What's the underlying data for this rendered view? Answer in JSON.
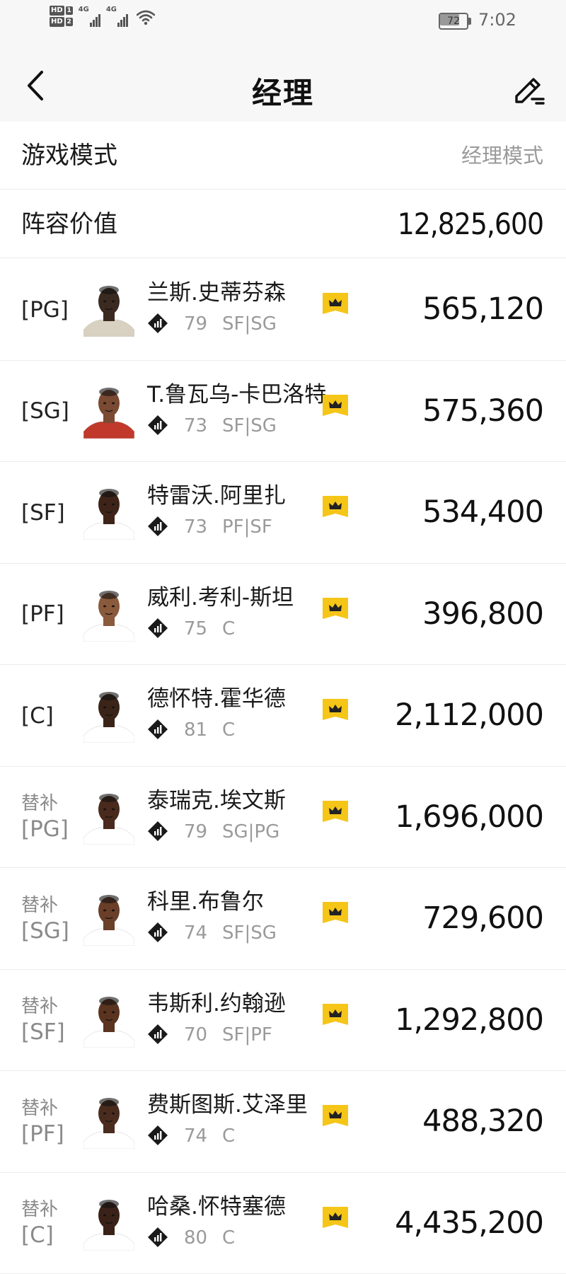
{
  "status_bar": {
    "sim1": "HD",
    "sim1_num": "1",
    "sim2": "HD",
    "sim2_num": "2",
    "network1": "4G",
    "network2": "4G",
    "battery": "72",
    "battery_level": 0.72,
    "time": "7:02"
  },
  "header": {
    "title": "经理",
    "back_icon": "chevron-left-icon",
    "edit_icon": "pencil-edit-icon"
  },
  "game_mode": {
    "label": "游戏模式",
    "value": "经理模式"
  },
  "lineup_value": {
    "label": "阵容价值",
    "value": "12,825,600"
  },
  "colors": {
    "crown": "#f5c518",
    "rating_icon": "#1a1a1a"
  },
  "players": [
    {
      "sub_label": "",
      "pos": "[PG]",
      "name": "兰斯.史蒂芬森",
      "rating": "79",
      "role": "SF|SG",
      "price": "565,120",
      "skin": "#3a2a20",
      "jersey": "#d8d0c0"
    },
    {
      "sub_label": "",
      "pos": "[SG]",
      "name": "T.鲁瓦乌-卡巴洛特",
      "rating": "73",
      "role": "SF|SG",
      "price": "575,360",
      "skin": "#7a4a32",
      "jersey": "#c0392b"
    },
    {
      "sub_label": "",
      "pos": "[SF]",
      "name": "特雷沃.阿里扎",
      "rating": "73",
      "role": "PF|SF",
      "price": "534,400",
      "skin": "#3e2418",
      "jersey": "#ffffff"
    },
    {
      "sub_label": "",
      "pos": "[PF]",
      "name": "威利.考利-斯坦",
      "rating": "75",
      "role": "C",
      "price": "396,800",
      "skin": "#8a5a3c",
      "jersey": "#ffffff"
    },
    {
      "sub_label": "",
      "pos": "[C]",
      "name": "德怀特.霍华德",
      "rating": "81",
      "role": "C",
      "price": "2,112,000",
      "skin": "#3a2418",
      "jersey": "#ffffff"
    },
    {
      "sub_label": "替补",
      "pos": "[PG]",
      "name": "泰瑞克.埃文斯",
      "rating": "79",
      "role": "SG|PG",
      "price": "1,696,000",
      "skin": "#4a2a1c",
      "jersey": "#ffffff"
    },
    {
      "sub_label": "替补",
      "pos": "[SG]",
      "name": "科里.布鲁尔",
      "rating": "74",
      "role": "SF|SG",
      "price": "729,600",
      "skin": "#6a3e28",
      "jersey": "#ffffff"
    },
    {
      "sub_label": "替补",
      "pos": "[SF]",
      "name": "韦斯利.约翰逊",
      "rating": "70",
      "role": "SF|PF",
      "price": "1,292,800",
      "skin": "#5a341f",
      "jersey": "#ffffff"
    },
    {
      "sub_label": "替补",
      "pos": "[PF]",
      "name": "费斯图斯.艾泽里",
      "rating": "74",
      "role": "C",
      "price": "488,320",
      "skin": "#4a2c1e",
      "jersey": "#ffffff"
    },
    {
      "sub_label": "替补",
      "pos": "[C]",
      "name": "哈桑.怀特塞德",
      "rating": "80",
      "role": "C",
      "price": "4,435,200",
      "skin": "#3a2218",
      "jersey": "#ffffff"
    }
  ]
}
